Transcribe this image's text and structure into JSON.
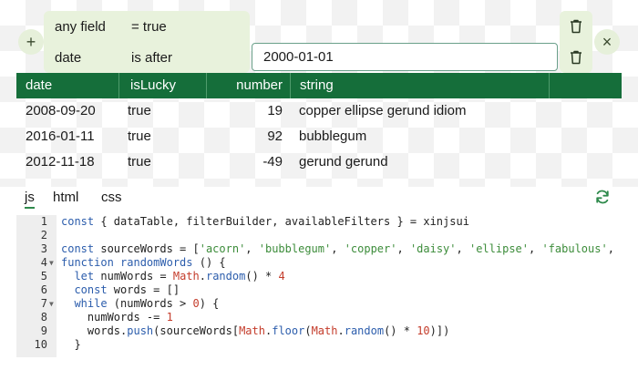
{
  "filter": {
    "rows": [
      {
        "field": "any field",
        "op": "= true"
      },
      {
        "field": "date",
        "op": "is after"
      }
    ],
    "date_value": "2000-01-01",
    "add_label": "+",
    "close_label": "×"
  },
  "table": {
    "columns": [
      "date",
      "isLucky",
      "number",
      "string"
    ],
    "rows": [
      [
        "2008-09-20",
        "true",
        "19",
        "copper ellipse gerund idiom"
      ],
      [
        "2016-01-11",
        "true",
        "92",
        "bubblegum"
      ],
      [
        "2012-11-18",
        "true",
        "-49",
        "gerund gerund"
      ]
    ]
  },
  "tabs": [
    "js",
    "html",
    "css"
  ],
  "active_tab": "js",
  "editor": {
    "line_numbers": [
      "1",
      "2",
      "3",
      "4",
      "5",
      "6",
      "7",
      "8",
      "9",
      "10"
    ],
    "lines": [
      "const { dataTable, filterBuilder, availableFilters } = xinjsui",
      "",
      "const sourceWords = ['acorn', 'bubblegum', 'copper', 'daisy', 'ellipse', 'fabulous', 'gerund'",
      "function randomWords () {",
      "  let numWords = Math.random() * 4",
      "  const words = []",
      "  while (numWords > 0) {",
      "    numWords -= 1",
      "    words.push(sourceWords[Math.floor(Math.random() * 10)])",
      "  }"
    ]
  },
  "colors": {
    "header_bg": "#156e3a",
    "filter_bg": "#e8f2dc",
    "accent": "#2f8a4c"
  },
  "icons": {
    "add": "plus-icon",
    "close": "close-icon",
    "delete": "trash-icon",
    "refresh": "refresh-icon"
  }
}
